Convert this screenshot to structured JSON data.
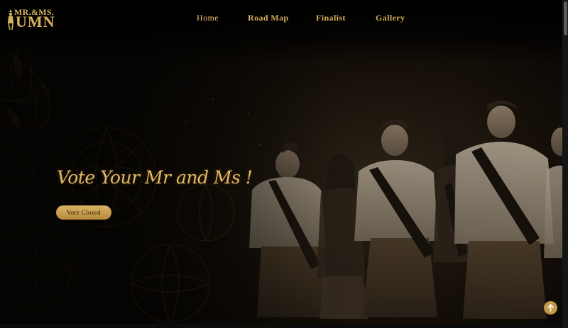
{
  "logo": {
    "line1": "MR.&MS.",
    "line2": "UMN"
  },
  "nav": {
    "items": [
      {
        "label": "Home",
        "active": true
      },
      {
        "label": "Road Map",
        "active": false
      },
      {
        "label": "Finalist",
        "active": false
      },
      {
        "label": "Gallery",
        "active": false
      }
    ]
  },
  "hero": {
    "headline": "Vote Your Mr and Ms !",
    "vote_button": "Vote Closed"
  },
  "icons": {
    "back_to_top": "arrow-up-icon"
  },
  "colors": {
    "accent_gold": "#d7b05b",
    "active_nav": "#f0c27a",
    "background": "#050402"
  }
}
